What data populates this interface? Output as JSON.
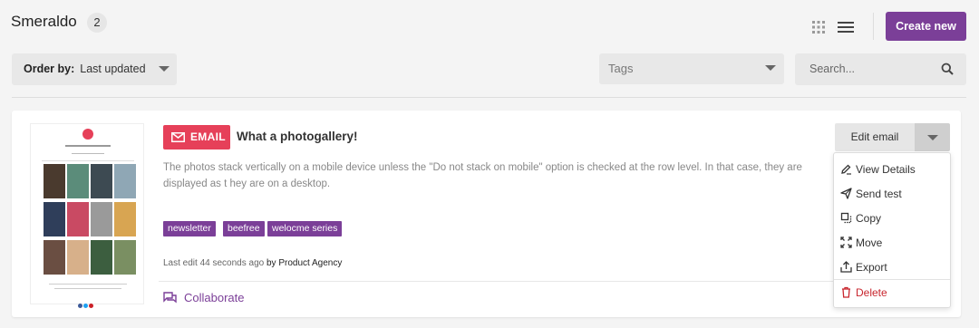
{
  "header": {
    "title": "Smeraldo",
    "count": "2",
    "create_label": "Create new"
  },
  "filters": {
    "order_label": "Order by:",
    "order_value": "Last updated",
    "tags_placeholder": "Tags",
    "search_placeholder": "Search..."
  },
  "card": {
    "type_label": "EMAIL",
    "title": "What a photogallery!",
    "description": "The photos stack vertically on a mobile device unless the \"Do not stack on mobile\" option is checked at the row level. In that case, they are displayed as t hey are on a desktop.",
    "tags": [
      "newsletter",
      "beefree",
      "welocme series"
    ],
    "last_edit_prefix": "Last edit 44 seconds ago",
    "last_edit_by": "by Product Agency",
    "collaborate_label": "Collaborate",
    "edit_label": "Edit email",
    "thumbnail_heading": "NEW HIGH PHOTOGRAPHY"
  },
  "menu": {
    "items": [
      {
        "label": "View Details",
        "icon": "pencil-icon"
      },
      {
        "label": "Send test",
        "icon": "paper-plane-icon"
      },
      {
        "label": "Copy",
        "icon": "copy-icon"
      },
      {
        "label": "Move",
        "icon": "move-icon"
      },
      {
        "label": "Export",
        "icon": "export-icon"
      }
    ],
    "delete_label": "Delete"
  },
  "colors": {
    "brand": "#7b3f98",
    "email_badge": "#e64059",
    "danger": "#c8262e"
  }
}
